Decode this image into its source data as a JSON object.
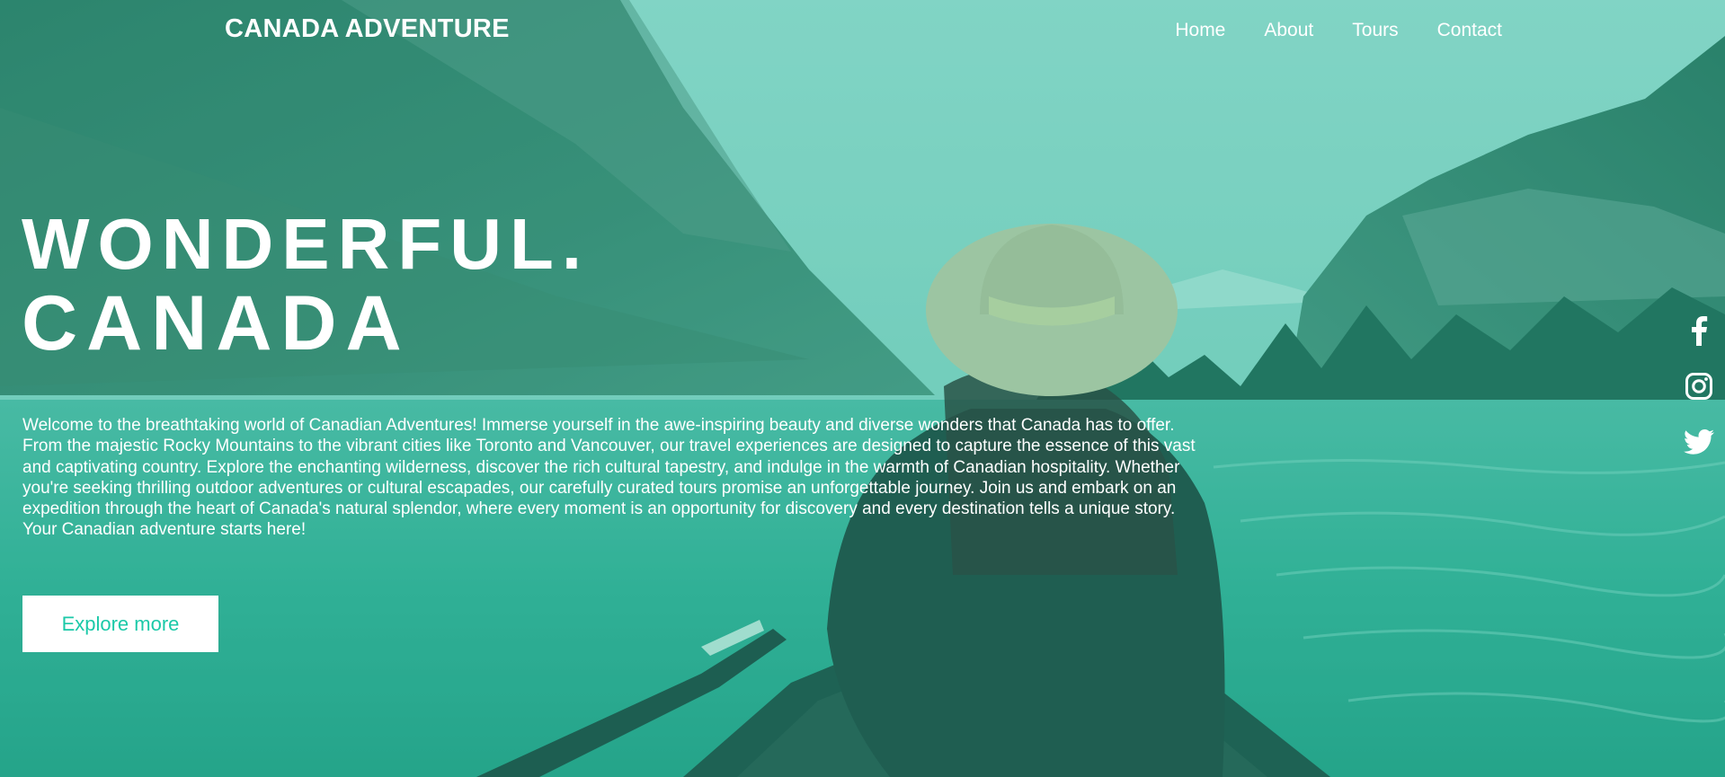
{
  "header": {
    "brand": "CANADA ADVENTURE",
    "nav": [
      {
        "label": "Home"
      },
      {
        "label": "About"
      },
      {
        "label": "Tours"
      },
      {
        "label": "Contact"
      }
    ]
  },
  "hero": {
    "title_line1": "WONDERFUL.",
    "title_line2": "CANADA",
    "description": "Welcome to the breathtaking world of Canadian Adventures! Immerse yourself in the awe-inspiring beauty and diverse wonders that Canada has to offer. From the majestic Rocky Mountains to the vibrant cities like Toronto and Vancouver, our travel experiences are designed to capture the essence of this vast and captivating country. Explore the enchanting wilderness, discover the rich cultural tapestry, and indulge in the warmth of Canadian hospitality. Whether you're seeking thrilling outdoor adventures or cultural escapades, our carefully curated tours promise an unforgettable journey. Join us and embark on an expedition through the heart of Canada's natural splendor, where every moment is an opportunity for discovery and every destination tells a unique story. Your Canadian adventure starts here!",
    "cta_label": "Explore more"
  },
  "social": {
    "icons": [
      "facebook-icon",
      "instagram-icon",
      "twitter-icon"
    ]
  },
  "colors": {
    "accent": "#1bc9a8",
    "text": "#ffffff",
    "button_bg": "#ffffff"
  }
}
